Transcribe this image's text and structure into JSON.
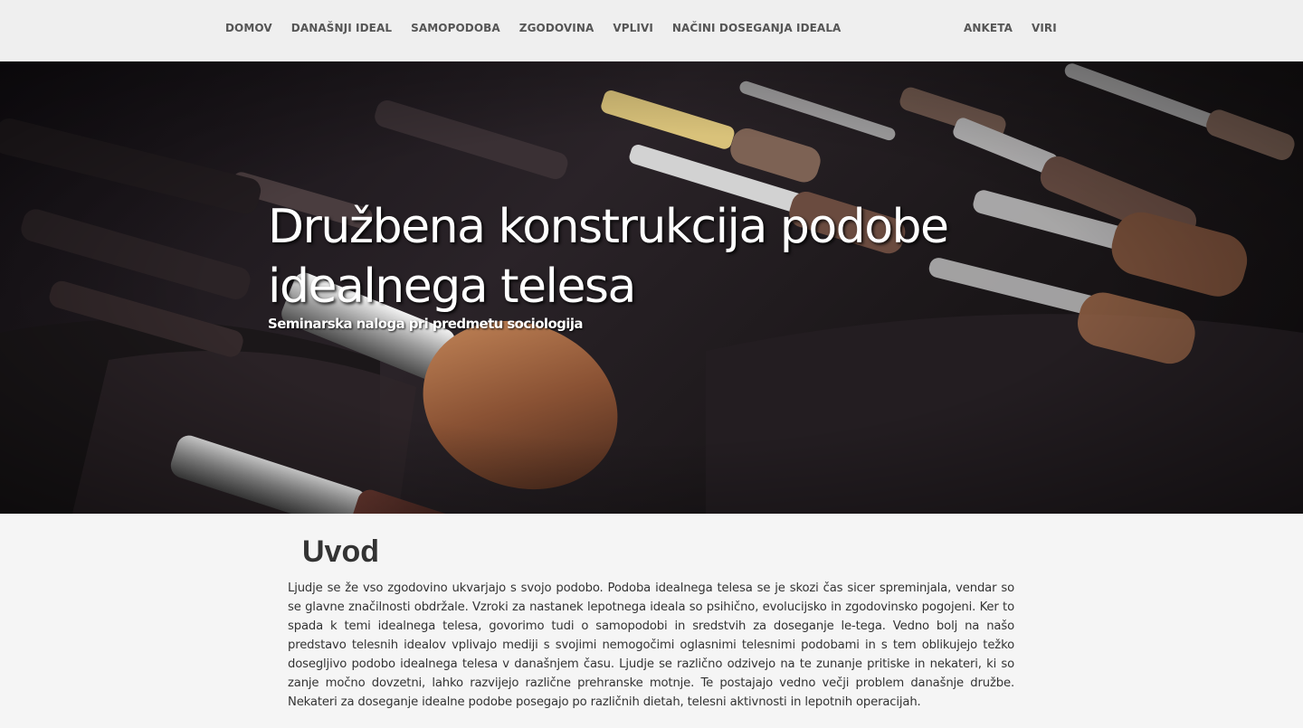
{
  "nav": {
    "left_items": [
      {
        "label": "DOMOV"
      },
      {
        "label": "DANAŠNJI IDEAL"
      },
      {
        "label": "SAMOPODOBA"
      },
      {
        "label": "ZGODOVINA"
      },
      {
        "label": "VPLIVI"
      },
      {
        "label": "NAČINI DOSEGANJA IDEALA"
      }
    ],
    "right_items": [
      {
        "label": "ANKETA"
      },
      {
        "label": "VIRI"
      }
    ]
  },
  "hero": {
    "title_line1": "Družbena konstrukcija podobe",
    "title_line2": "idealnega telesa",
    "subtitle": "Seminarska naloga pri predmetu sociologija"
  },
  "intro": {
    "heading": "Uvod",
    "text": "Ljudje se že vso zgodovino ukvarjajo s svojo podobo. Podoba idealnega telesa se je skozi čas sicer spreminjala, vendar so se glavne značilnosti obdržale. Vzroki za nastanek lepotnega ideala so psihično, evolucijsko in zgodovinsko pogojeni. Ker to spada k temi idealnega telesa, govorimo tudi o samopodobi in sredstvih za doseganje le-tega. Vedno bolj na našo predstavo telesnih idealov vplivajo mediji s svojimi nemogočimi oglasnimi telesnimi podobami in s tem oblikujejo težko dosegljivo podobo idealnega telesa v današnjem času. Ljudje se različno odzivejo na te zunanje pritiske in nekateri, ki so zanje močno dovzetni, lahko razvijejo različne prehranske motnje. Te postajajo vedno večji problem današnje družbe. Nekateri za doseganje idealne podobe posegajo po različnih dietah, telesni aktivnosti in lepotnih operacijah."
  }
}
